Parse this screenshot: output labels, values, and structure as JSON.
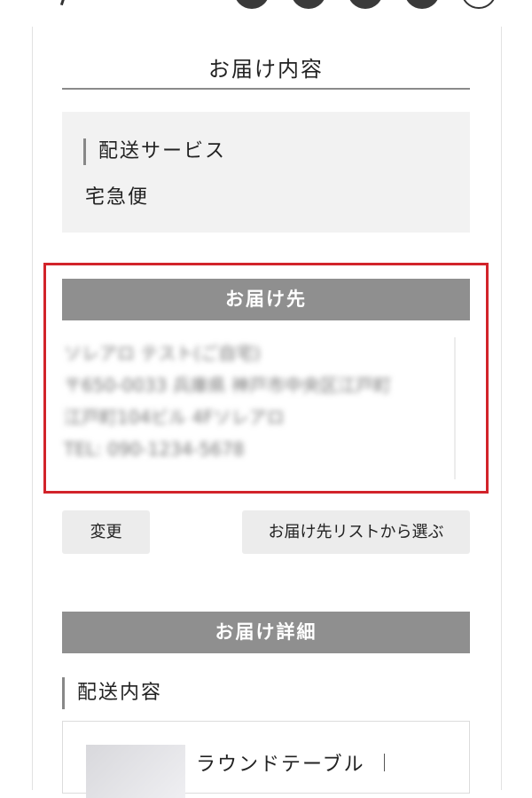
{
  "delivery": {
    "section_title": "お届け内容",
    "service_label": "配送サービス",
    "service_value": "宅急便"
  },
  "destination": {
    "header": "お届け先",
    "address_lines": [
      "ソレアロ テスト(ご自宅)",
      "〒650-0033 兵庫県 神戸市中央区江戸町",
      "江戸町104ビル 4Fソレアロ",
      "TEL: 090-1234-5678"
    ],
    "change_button": "変更",
    "choose_from_list_button": "お届け先リストから選ぶ"
  },
  "details": {
    "header": "お届け詳細",
    "content_label": "配送内容",
    "item_name": "ラウンドテーブル"
  },
  "colors": {
    "highlight_border": "#d2232a",
    "header_bar": "#8f8f8f"
  }
}
